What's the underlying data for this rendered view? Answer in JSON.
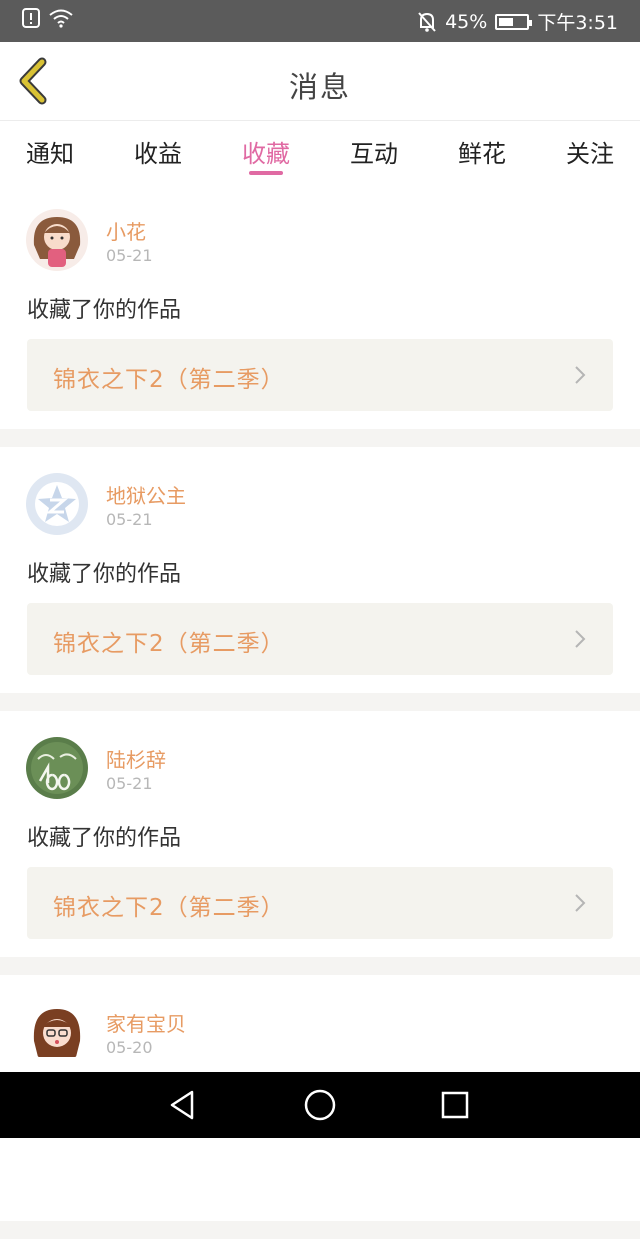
{
  "status_bar": {
    "battery": "45%",
    "time": "下午3:51"
  },
  "header": {
    "title": "消息"
  },
  "tabs": [
    {
      "label": "通知",
      "active": false
    },
    {
      "label": "收益",
      "active": false
    },
    {
      "label": "收藏",
      "active": true
    },
    {
      "label": "互动",
      "active": false
    },
    {
      "label": "鲜花",
      "active": false
    },
    {
      "label": "关注",
      "active": false
    }
  ],
  "messages": [
    {
      "user": "小花",
      "date": "05-21",
      "action": "收藏了你的作品",
      "work": "锦衣之下2（第二季）"
    },
    {
      "user": "地狱公主",
      "date": "05-21",
      "action": "收藏了你的作品",
      "work": "锦衣之下2（第二季）"
    },
    {
      "user": "陆杉辞",
      "date": "05-21",
      "action": "收藏了你的作品",
      "work": "锦衣之下2（第二季）"
    },
    {
      "user": "家有宝贝",
      "date": "05-20",
      "action": "",
      "work": ""
    }
  ],
  "colors": {
    "accent": "#e06aa3",
    "name": "#e79b63",
    "back_icon": "#d9c234"
  }
}
